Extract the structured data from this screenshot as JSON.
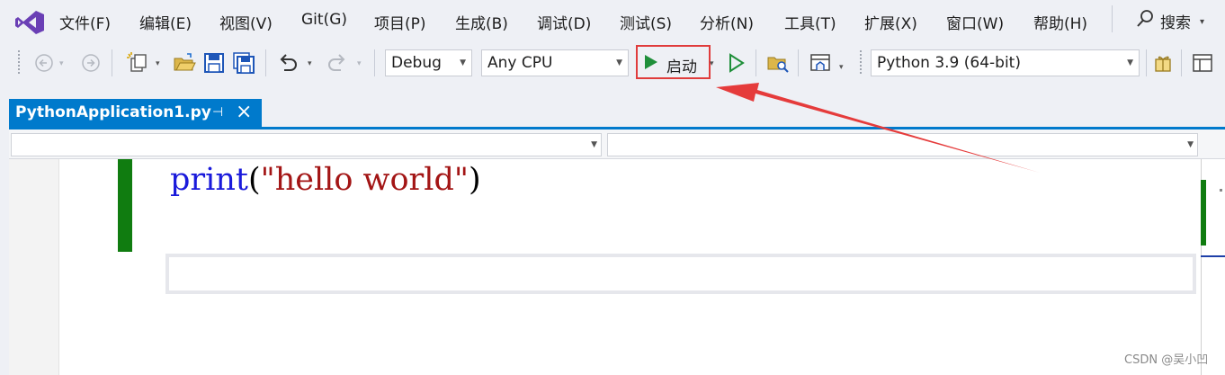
{
  "menu": {
    "items": [
      "文件(F)",
      "编辑(E)",
      "视图(V)",
      "Git(G)",
      "项目(P)",
      "生成(B)",
      "调试(D)",
      "测试(S)",
      "分析(N)",
      "工具(T)",
      "扩展(X)",
      "窗口(W)",
      "帮助(H)"
    ],
    "search_label": "搜索"
  },
  "toolbar": {
    "configuration": "Debug",
    "platform": "Any CPU",
    "start_label": "启动",
    "environment": "Python 3.9 (64-bit)"
  },
  "tabs": [
    {
      "label": "PythonApplication1.py",
      "active": true
    }
  ],
  "editor": {
    "code_function": "print",
    "code_open": "(",
    "code_string": "\"hello world\"",
    "code_close": ")"
  },
  "watermark": "CSDN @吴小凹",
  "colors": {
    "accent": "#007acc",
    "run_green": "#1f8f3a",
    "highlight_red": "#e03c3c",
    "change_bar": "#107c10"
  }
}
